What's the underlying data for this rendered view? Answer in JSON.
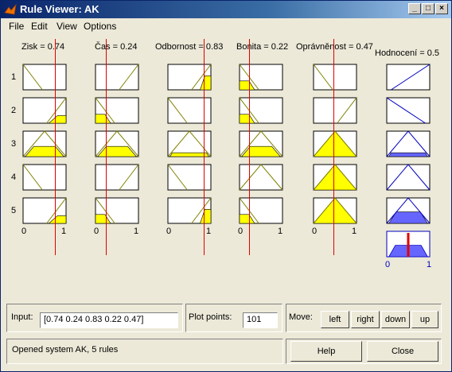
{
  "window": {
    "title": "Rule Viewer: AK"
  },
  "menu": [
    "File",
    "Edit",
    "View",
    "Options"
  ],
  "inputs": [
    {
      "label": "Zisk = 0.74",
      "value": 0.74
    },
    {
      "label": "Čas = 0.24",
      "value": 0.24
    },
    {
      "label": "Odbornost = 0.83",
      "value": 0.83
    },
    {
      "label": "Bonita = 0.22",
      "value": 0.22
    },
    {
      "label": "Oprávněnost = 0.47",
      "value": 0.47
    }
  ],
  "output": {
    "label": "Hodnocení = 0.5",
    "value": 0.5
  },
  "rule_numbers": [
    "1",
    "2",
    "3",
    "4",
    "5"
  ],
  "axis_ticks": {
    "min": "0",
    "max": "1"
  },
  "controls": {
    "input_label": "Input:",
    "input_value": "[0.74 0.24 0.83 0.22 0.47]",
    "plot_points_label": "Plot points:",
    "plot_points_value": "101",
    "move_label": "Move:",
    "left": "left",
    "right": "right",
    "down": "down",
    "up": "up",
    "help": "Help",
    "close": "Close",
    "status": "Opened system AK, 5 rules"
  },
  "colors": {
    "fill": "#ffff00",
    "output_fill": "#6666ff",
    "crisp_line": "#e00000",
    "mf_line": "#808000",
    "out_line": "#0000c0"
  }
}
